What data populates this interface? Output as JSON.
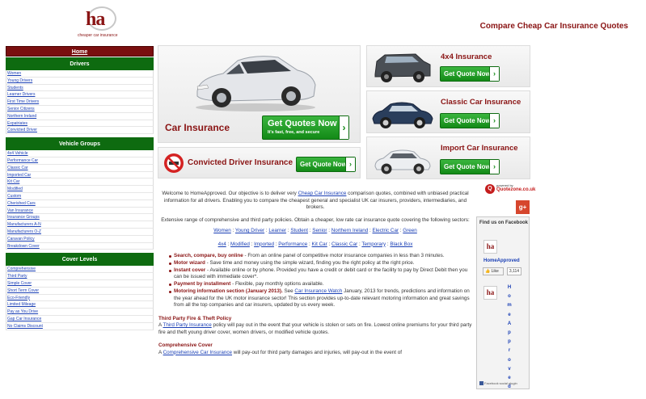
{
  "logo": {
    "mark": "ha",
    "tagline": "cheaper car insurance"
  },
  "site_tagline": "Compare Cheap Car Insurance Quotes",
  "nav": {
    "home": "Home",
    "drivers_header": "Drivers",
    "drivers": [
      "Women",
      "Young Drivers",
      "Students",
      "Learner Drivers",
      "First Time Drivers",
      "Senior Citizens",
      "Northern Ireland",
      "Expatriates",
      "Convicted Driver"
    ],
    "vehicle_header": "Vehicle Groups",
    "vehicles": [
      "4x4 Vehicle",
      "Performance Car",
      "Classic Car",
      "Imported Car",
      "Kit Car",
      "Modified",
      "Custom",
      "Cherished Cars",
      "Van Insurance",
      "Insurance Groups",
      "Manufacturers A-N",
      "Manufacturers O-Z",
      "Caravan Policy",
      "Breakdown Cover"
    ],
    "cover_header": "Cover Levels",
    "covers": [
      "Comprehensive",
      "Third Party",
      "Simple Cover",
      "Short Term Cover",
      "Eco-Friendly",
      "Limited Mileage",
      "Pay as You Drive",
      "Gap Car Insurance",
      "No Claims Discount"
    ]
  },
  "promo": {
    "main_title": "Car Insurance",
    "main_button": "Get Quotes Now",
    "main_button_sub": "It's fast, free, and secure",
    "convicted_title": "Convicted Driver Insurance",
    "side": [
      {
        "title": "4x4 Insurance",
        "button": "Get Quote Now"
      },
      {
        "title": "Classic Car Insurance",
        "button": "Get Quote Now"
      },
      {
        "title": "Import Car Insurance",
        "button": "Get Quote Now"
      }
    ],
    "small_button": "Get Quote Now",
    "colors": {
      "brand": "#8a1414",
      "nav_green": "#0e6b10",
      "button_green": "#1f9a23"
    }
  },
  "powered": {
    "label": "powered by",
    "brand": "Quotezone.co.uk"
  },
  "gplus": "g+",
  "facebook": {
    "header": "Find us on Facebook",
    "page_name": "HomeApproved",
    "like": "Like",
    "count": "3,114",
    "vertical": [
      "H",
      "o",
      "m",
      "e",
      "A",
      "p",
      "p",
      "r",
      "o",
      "v",
      "e",
      "d"
    ],
    "plugin": "Facebook social plugin"
  },
  "content": {
    "intro_a": "Welcome to HomeApproved. Our objective is to deliver very ",
    "intro_link": "Cheap Car Insurance",
    "intro_b": " comparison quotes, combined with unbiased practical information for all drivers. Enabling you to compare the cheapest general and specialist UK car insurers, providers, intermediaries, and brokers.",
    "intro2": "Extensive range of comprehensive and third party policies. Obtain a cheaper, low rate car insurance quote covering the following sectors:",
    "links_row1": [
      "Women",
      "Young Driver",
      "Learner",
      "Student",
      "Senior",
      "Northern Ireland",
      "Electric Car",
      "Green"
    ],
    "links_row2": [
      "4x4",
      "Modified",
      "Imported",
      "Performance",
      "Kit Car",
      "Classic Car",
      "Temporary",
      "Black Box"
    ],
    "bullets": [
      {
        "bold": "Search, compare, buy online",
        "text": " - From an online panel of competitive motor insurance companies in less than 3 minutes."
      },
      {
        "bold": "Motor wizard",
        "text": " - Save time and money using the simple wizard, finding you the right policy at the right price."
      },
      {
        "bold": "Instant cover",
        "text": " - Available online or by phone. Provided you have a credit or debit card or the facility to pay by Direct Debit then you can be issued with immediate cover*."
      },
      {
        "bold": "Payment by installment",
        "text": " - Flexible, pay monthly options available."
      }
    ],
    "bullet5_bold": "Motoring information section (January 2013).",
    "bullet5_pre": " See ",
    "bullet5_link": "Car Insurance Watch",
    "bullet5_post": " January, 2013 for trends, predictions and information on the year ahead for the UK motor insurance sector! This section provides up-to-date relevant motoring information and great savings from all the top companies and car insurers, updated by us every week.",
    "tp_title": "Third Party Fire & Theft Policy",
    "tp_a": "A ",
    "tp_link": "Third Party Insurance",
    "tp_b": " policy will pay out in the event that your vehicle is stolen or sets on fire. Lowest online premiums for your third party fire and theft young driver cover, women drivers, or modified vehicle quotes.",
    "comp_title": "Comprehensive Cover",
    "comp_a": "A ",
    "comp_link": "Comprehensive Car Insurance",
    "comp_b": " will pay-out for third party damages and injuries, will pay-out in the event of"
  }
}
